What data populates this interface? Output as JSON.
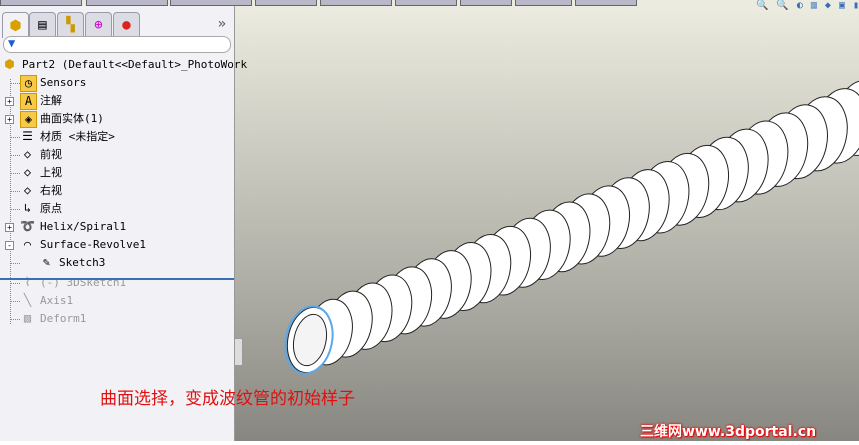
{
  "panel_tabs": [
    "feature-manager",
    "property-manager",
    "configuration-manager",
    "dimxpert-manager",
    "display-manager"
  ],
  "more_label": "»",
  "tree": {
    "root": "Part2  (Default<<Default>_PhotoWork",
    "items": [
      {
        "label": "Sensors",
        "icon": "sensor-folder-icon",
        "expand": ""
      },
      {
        "label": "注解",
        "icon": "annotation-folder-icon",
        "expand": "+"
      },
      {
        "label": "曲面实体(1)",
        "icon": "surface-bodies-folder-icon",
        "expand": "+"
      },
      {
        "label": "材质 <未指定>",
        "icon": "material-icon",
        "expand": ""
      },
      {
        "label": "前视",
        "icon": "plane-icon",
        "expand": ""
      },
      {
        "label": "上视",
        "icon": "plane-icon",
        "expand": ""
      },
      {
        "label": "右视",
        "icon": "plane-icon",
        "expand": ""
      },
      {
        "label": "原点",
        "icon": "origin-icon",
        "expand": ""
      },
      {
        "label": "Helix/Spiral1",
        "icon": "helix-icon",
        "expand": "+"
      },
      {
        "label": "Surface-Revolve1",
        "icon": "surface-revolve-icon",
        "expand": "-"
      }
    ],
    "child": {
      "label": "Sketch3",
      "icon": "sketch-icon"
    },
    "suppressed": [
      {
        "label": "(-) 3DSketch1",
        "icon": "3dsketch-icon"
      },
      {
        "label": "Axis1",
        "icon": "axis-icon"
      },
      {
        "label": "Deform1",
        "icon": "deform-icon"
      }
    ]
  },
  "caption": "曲面选择，变成波纹管的初始样子",
  "watermark": "三维网www.3dportal.cn",
  "colors": {
    "caption": "#e01010",
    "tube": "#ffffff",
    "selected_edge": "#5aa8e8"
  }
}
